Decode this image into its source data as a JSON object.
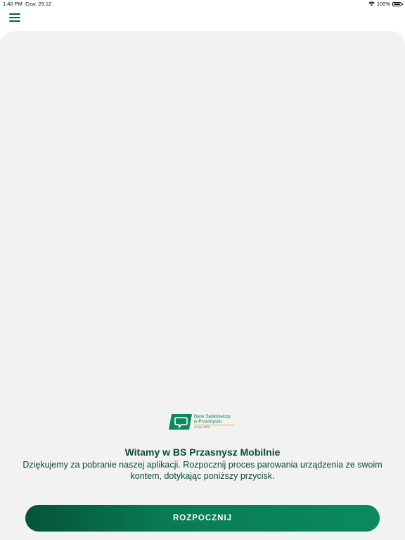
{
  "status_bar": {
    "time": "1:40 PM",
    "date": "Czw. 29.12",
    "battery": "100%",
    "icons": [
      "wifi-icon",
      "battery-icon"
    ]
  },
  "header": {
    "menu_icon": "hamburger-menu-icon"
  },
  "logo": {
    "line1": "Bank Spółdzielczy",
    "line2": "w Przasnyszu",
    "sub": "Grupa BPS",
    "colors": {
      "mark": "#0b8a5e",
      "accent_line": "#c9b84a"
    }
  },
  "welcome": {
    "title": "Witamy w BS Przasnysz Mobilnie",
    "text": "Dziękujemy za pobranie naszej aplikacji. Rozpocznij proces parowania urządzenia ze swoim kontem, dotykając poniższy przycisk."
  },
  "actions": {
    "start_label": "ROZPOCZNIJ"
  },
  "colors": {
    "primary": "#0b8a5e",
    "primary_dark": "#045437",
    "text_dark_green": "#0b4a35",
    "card_background": "#f2f2f2"
  }
}
